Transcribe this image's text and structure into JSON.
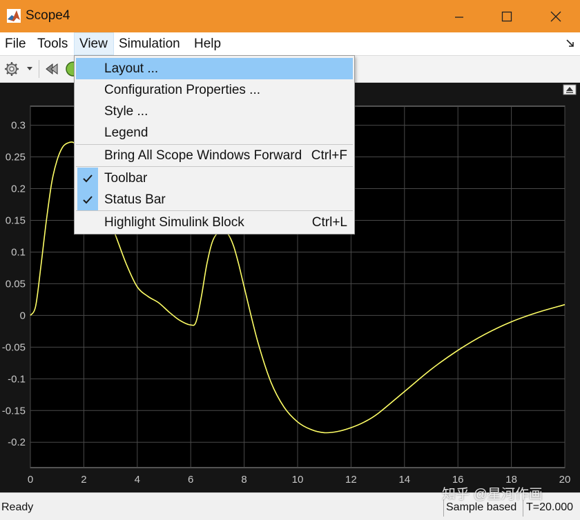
{
  "window": {
    "title": "Scope4"
  },
  "menubar": {
    "items": [
      "File",
      "Tools",
      "View",
      "Simulation",
      "Help"
    ],
    "active": "View"
  },
  "view_menu": {
    "items": [
      {
        "label": "Layout ...",
        "shortcut": "",
        "checked": false,
        "highlighted": true
      },
      {
        "label": "Configuration Properties ...",
        "shortcut": "",
        "checked": false,
        "highlighted": false
      },
      {
        "label": "Style ...",
        "shortcut": "",
        "checked": false,
        "highlighted": false
      },
      {
        "label": "Legend",
        "shortcut": "",
        "checked": false,
        "highlighted": false
      },
      {
        "label": "Bring All Scope Windows Forward",
        "shortcut": "Ctrl+F",
        "checked": false,
        "highlighted": false
      },
      {
        "label": "Toolbar",
        "shortcut": "",
        "checked": true,
        "highlighted": false
      },
      {
        "label": "Status Bar",
        "shortcut": "",
        "checked": true,
        "highlighted": false
      },
      {
        "label": "Highlight Simulink Block",
        "shortcut": "Ctrl+L",
        "checked": false,
        "highlighted": false
      }
    ]
  },
  "toolbar": {
    "icons": [
      "gear-icon",
      "dropdown-arrow-icon",
      "rewind-icon",
      "run-icon"
    ]
  },
  "status": {
    "ready": "Ready",
    "mode": "Sample based",
    "time": "T=20.000"
  },
  "watermark": "知乎 @星河作画",
  "colors": {
    "titlebar": "#f0912b",
    "plot_bg": "#000000",
    "trace": "#ffff66",
    "menu_highlight": "#91c9f7"
  },
  "chart_data": {
    "type": "line",
    "xlim": [
      0,
      20
    ],
    "ylim": [
      -0.24,
      0.33
    ],
    "xticks": [
      0,
      2,
      4,
      6,
      8,
      10,
      12,
      14,
      16,
      18,
      20
    ],
    "yticks": [
      -0.2,
      -0.15,
      -0.1,
      -0.05,
      0,
      0.05,
      0.1,
      0.15,
      0.2,
      0.25,
      0.3
    ],
    "ytick_labels": [
      "-0.2",
      "-0.15",
      "-0.1",
      "-0.05",
      "0",
      "0.05",
      "0.1",
      "0.15",
      "0.2",
      "0.25",
      "0.3"
    ],
    "grid": true,
    "series": [
      {
        "color": "#ffff66",
        "x": [
          0,
          0.2,
          0.4,
          0.6,
          0.8,
          1.0,
          1.2,
          1.4,
          1.6,
          1.8,
          2.0,
          2.4,
          2.8,
          3.2,
          3.6,
          4.0,
          4.4,
          4.8,
          5.2,
          5.6,
          6.0,
          6.2,
          6.4,
          6.6,
          6.8,
          7.0,
          7.2,
          7.4,
          7.6,
          7.8,
          8.0,
          8.5,
          9.0,
          9.5,
          10.0,
          10.5,
          11.0,
          11.5,
          12.0,
          12.5,
          13.0,
          14.0,
          15.0,
          16.0,
          17.0,
          18.0,
          19.0,
          20.0
        ],
        "y": [
          0,
          0.015,
          0.08,
          0.15,
          0.21,
          0.245,
          0.265,
          0.272,
          0.273,
          0.265,
          0.25,
          0.215,
          0.17,
          0.125,
          0.08,
          0.045,
          0.03,
          0.02,
          0.005,
          -0.008,
          -0.015,
          -0.01,
          0.03,
          0.08,
          0.115,
          0.13,
          0.133,
          0.128,
          0.11,
          0.08,
          0.045,
          -0.04,
          -0.105,
          -0.145,
          -0.168,
          -0.18,
          -0.185,
          -0.183,
          -0.177,
          -0.168,
          -0.155,
          -0.12,
          -0.085,
          -0.055,
          -0.03,
          -0.01,
          0.005,
          0.017
        ]
      }
    ]
  }
}
